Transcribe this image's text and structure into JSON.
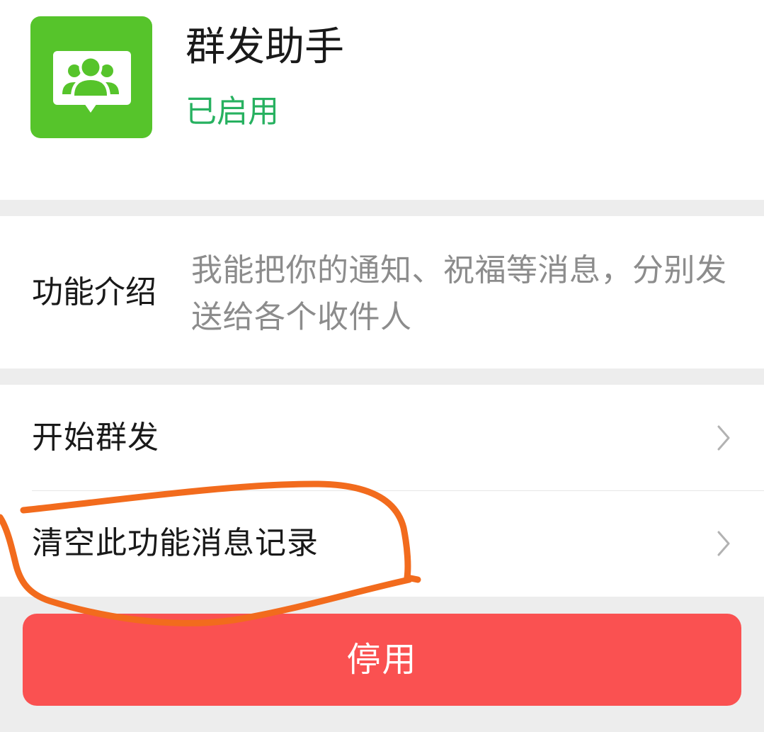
{
  "plugin": {
    "name": "群发助手",
    "status": "已启用",
    "icon": "group-message-icon",
    "accent_color": "#56c42b",
    "status_color": "#27b160"
  },
  "intro": {
    "label": "功能介绍",
    "description": "我能把你的通知、祝福等消息，分别发送给各个收件人"
  },
  "actions": [
    {
      "label": "开始群发",
      "icon": "chevron-right-icon"
    },
    {
      "label": "清空此功能消息记录",
      "icon": "chevron-right-icon"
    }
  ],
  "disable_button": {
    "label": "停用",
    "color": "#fa5151"
  },
  "annotation": {
    "color": "#f26b1d"
  }
}
